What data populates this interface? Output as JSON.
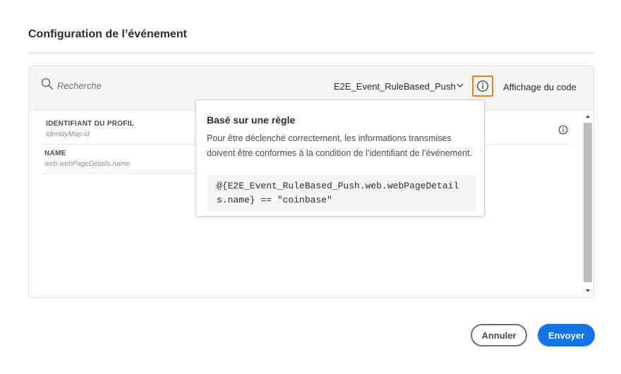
{
  "dialog": {
    "title": "Configuration de l’événement"
  },
  "toolbar": {
    "search_placeholder": "Recherche",
    "event_name": "E2E_Event_RuleBased_Push",
    "code_view_label": "Affichage du code"
  },
  "fields": [
    {
      "label": "IDENTIFIANT DU PROFIL",
      "path": "identityMap.id"
    },
    {
      "label": "NAME",
      "path": "web.webPageDetails.name"
    }
  ],
  "tooltip": {
    "title": "Basé sur une règle",
    "body": "Pour être déclenché correctement, les informations transmises doivent être conformes à la condition de l’identifiant de l’événement.",
    "code": "@{E2E_Event_RuleBased_Push.web.webPageDetails.name} == \"coinbase\""
  },
  "footer": {
    "cancel_label": "Annuler",
    "submit_label": "Envoyer"
  },
  "colors": {
    "accent": "#1473e6",
    "focus_ring": "#e68619"
  }
}
